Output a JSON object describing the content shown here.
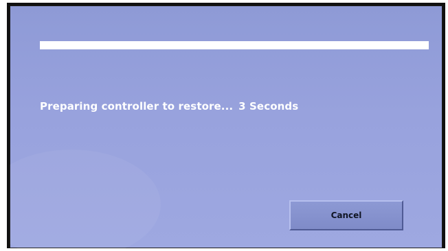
{
  "screen": {
    "background_color": "#98a2dd",
    "accent_color": "#ffffff"
  },
  "progress": {
    "fraction": 1.0
  },
  "status": {
    "message": "Preparing controller to restore...",
    "countdown": "3 Seconds"
  },
  "actions": {
    "cancel_label": "Cancel"
  }
}
